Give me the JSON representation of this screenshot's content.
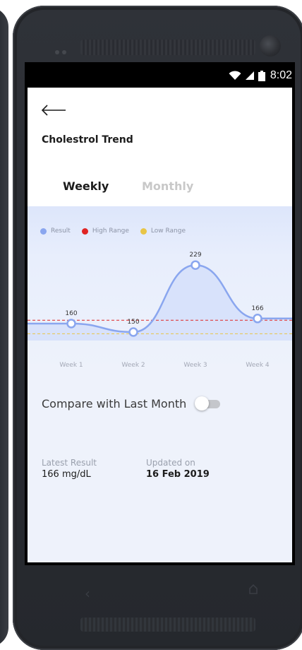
{
  "status_bar": {
    "time": "8:02"
  },
  "page": {
    "title": "Cholestrol Trend",
    "back_icon": "arrow-left-icon"
  },
  "tabs": [
    {
      "label": "Weekly",
      "active": true
    },
    {
      "label": "Monthly",
      "active": false
    }
  ],
  "legend": [
    {
      "label": "Result",
      "color": "#8aa6ef"
    },
    {
      "label": "High Range",
      "color": "#e02424"
    },
    {
      "label": "Low Range",
      "color": "#e8c547"
    }
  ],
  "chart_data": {
    "type": "line",
    "categories": [
      "Week 1",
      "Week 2",
      "Week 3",
      "Week 4"
    ],
    "series": [
      {
        "name": "Result",
        "values": [
          160,
          150,
          229,
          166
        ]
      }
    ],
    "reference_lines": [
      {
        "name": "High Range",
        "value": 164,
        "color": "#e02424"
      },
      {
        "name": "Low Range",
        "value": 148,
        "color": "#e8c547"
      }
    ],
    "ylim": [
      140,
      240
    ],
    "line_color": "#8aa6ef",
    "fill_color": "#d6e0fb",
    "data_labels": [
      "160",
      "150",
      "229",
      "166"
    ]
  },
  "compare": {
    "label": "Compare with Last Month",
    "enabled": false
  },
  "latest_result": {
    "label": "Latest Result",
    "value": "166 mg/dL"
  },
  "updated_on": {
    "label": "Updated on",
    "value": "16 Feb 2019"
  }
}
